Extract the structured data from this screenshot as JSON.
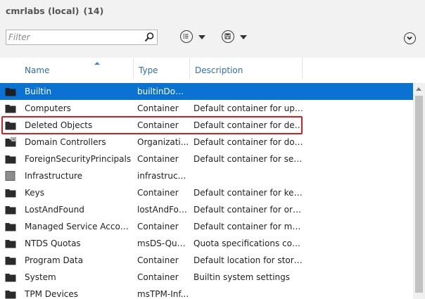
{
  "window": {
    "title": "cmrlabs (local)",
    "count": "(14)"
  },
  "toolbar": {
    "filter_placeholder": "Filter",
    "filter_value": ""
  },
  "columns": [
    {
      "label": "Name"
    },
    {
      "label": "Type"
    },
    {
      "label": "Description"
    }
  ],
  "rows": [
    {
      "icon": "folder-icon",
      "name": "Builtin",
      "type": "builtinDom...",
      "desc": "",
      "selected": true
    },
    {
      "icon": "folder-icon",
      "name": "Computers",
      "type": "Container",
      "desc": "Default container for upgr..."
    },
    {
      "icon": "folder-icon",
      "name": "Deleted Objects",
      "type": "Container",
      "desc": "Default container for delet..."
    },
    {
      "icon": "organizational-unit-icon",
      "name": "Domain Controllers",
      "type": "Organizati...",
      "desc": "Default container for dom..."
    },
    {
      "icon": "folder-icon",
      "name": "ForeignSecurityPrincipals",
      "type": "Container",
      "desc": "Default container for secur..."
    },
    {
      "icon": "infrastructure-icon",
      "name": "Infrastructure",
      "type": "infrastructu...",
      "desc": ""
    },
    {
      "icon": "folder-icon",
      "name": "Keys",
      "type": "Container",
      "desc": "Default container for key o..."
    },
    {
      "icon": "folder-icon",
      "name": "LostAndFound",
      "type": "lostAndFou...",
      "desc": "Default container for orph..."
    },
    {
      "icon": "folder-icon",
      "name": "Managed Service Accounts",
      "type": "Container",
      "desc": "Default container for man..."
    },
    {
      "icon": "folder-icon",
      "name": "NTDS Quotas",
      "type": "msDS-Quo...",
      "desc": "Quota specifications conta..."
    },
    {
      "icon": "folder-icon",
      "name": "Program Data",
      "type": "Container",
      "desc": "Default location for storag..."
    },
    {
      "icon": "folder-icon",
      "name": "System",
      "type": "Container",
      "desc": "Builtin system settings"
    },
    {
      "icon": "folder-icon",
      "name": "TPM Devices",
      "type": "msTPM-Inf...",
      "desc": ""
    }
  ],
  "colors": {
    "selection": "#0a73d1",
    "header_text": "#2e6db4",
    "highlight_border": "#d42020",
    "toolbar_bg": "#f2f2f2"
  }
}
